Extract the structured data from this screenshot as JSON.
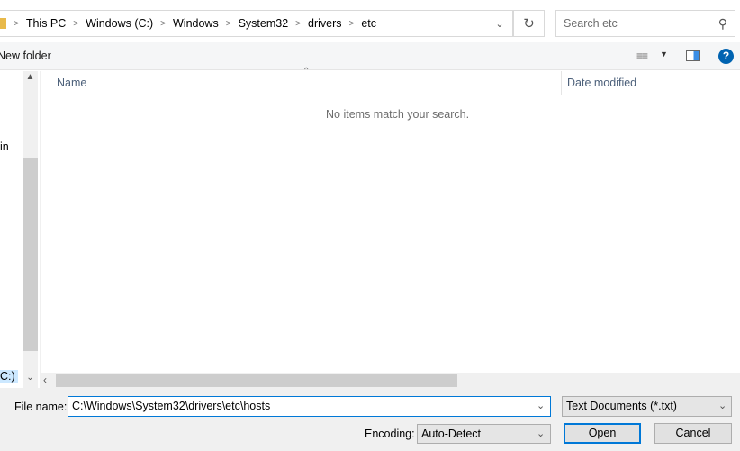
{
  "address": {
    "crumbs": [
      "This PC",
      "Windows (C:)",
      "Windows",
      "System32",
      "drivers",
      "etc"
    ]
  },
  "search": {
    "placeholder": "Search etc"
  },
  "toolbar": {
    "new_folder": "New folder",
    "help": "?"
  },
  "nav": {
    "partial_item": "in",
    "partial_drive": "C:)"
  },
  "columns": {
    "name": "Name",
    "date_modified": "Date modified"
  },
  "list": {
    "empty_message": "No items match your search."
  },
  "bottom": {
    "file_name_label": "File name:",
    "file_name_value": "C:\\Windows\\System32\\drivers\\etc\\hosts",
    "file_type": "Text Documents (*.txt)",
    "encoding_label": "Encoding:",
    "encoding_value": "Auto-Detect",
    "open": "Open",
    "cancel": "Cancel"
  },
  "colors": {
    "accent": "#0078d7",
    "help": "#0063b1"
  }
}
